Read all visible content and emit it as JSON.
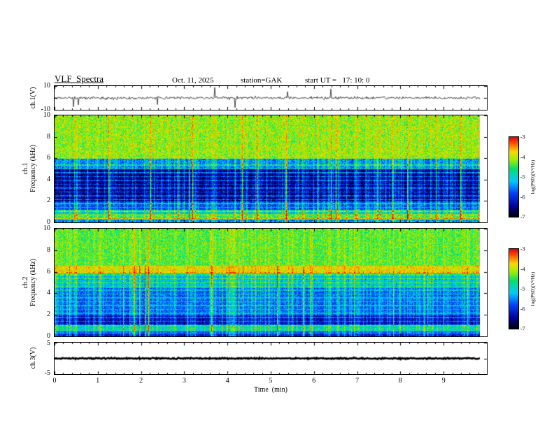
{
  "figure": {
    "title": "VLF  Spectra",
    "date": "Oct. 11, 2025",
    "station": "station=GAK",
    "start_ut": "start UT =   17: 10: 0"
  },
  "axes": {
    "time_label": "Time  (min)",
    "time_ticks": [
      "0",
      "1",
      "2",
      "3",
      "4",
      "5",
      "6",
      "7",
      "8",
      "9"
    ],
    "ch1_volt_ticks": [
      "10",
      "-10"
    ],
    "freq_ticks": [
      "10",
      "8",
      "6",
      "4",
      "2",
      "0"
    ],
    "ch3_volt_ticks": [
      "5",
      "-5"
    ],
    "ch1_volt_label": "ch.1(V)",
    "ch1_freq_label_line1": "ch.1",
    "ch1_freq_label_line2": "Frequency (kHz)",
    "ch2_freq_label_line1": "ch.2",
    "ch2_freq_label_line2": "Frequency (kHz)",
    "ch3_volt_label": "ch.3(V)"
  },
  "colorbar": {
    "label": "log(PSD)(V²/Hz)",
    "ticks": [
      "-3",
      "-4",
      "-5",
      "-6",
      "-7"
    ],
    "min": -7,
    "max": -3
  },
  "colormap": [
    [
      "0",
      "#000000"
    ],
    [
      "0.14",
      "#00009a"
    ],
    [
      "0.30",
      "#0040ff"
    ],
    [
      "0.45",
      "#00c8ff"
    ],
    [
      "0.60",
      "#00e070"
    ],
    [
      "0.72",
      "#9cf000"
    ],
    [
      "0.82",
      "#ffd800"
    ],
    [
      "0.92",
      "#ff5a00"
    ],
    [
      "1",
      "#e80000"
    ]
  ],
  "chart_data": [
    {
      "id": "ch1_waveform",
      "type": "line",
      "title": "ch.1 raw amplitude",
      "ylabel": "ch.1(V)",
      "ylim": [
        -10,
        10
      ],
      "yticks": [
        10,
        -10
      ],
      "xlim": [
        0,
        10
      ],
      "xlabel": "Time (min)",
      "description": "Black broadband noise trace centered on 0 V with ~±2 V ripple and sporadic impulsive sferic spikes reaching about ±10 V; data span 0 to ~9.8 min",
      "render": {
        "noise_sigma": 1.1,
        "spike_prob": 0.012,
        "spike_amp": [
          5,
          10
        ],
        "seed": 11,
        "thick": 0.7,
        "yticks_draw": [
          10,
          0,
          -10
        ]
      }
    },
    {
      "id": "ch1_spectrogram",
      "type": "heatmap",
      "title": "ch.1 VLF spectrogram",
      "ylabel": "ch.1 Frequency (kHz)",
      "ylim": [
        0,
        10
      ],
      "yticks": [
        0,
        2,
        4,
        6,
        8,
        10
      ],
      "xlim": [
        0,
        10
      ],
      "xlabel": "Time (min)",
      "value_label": "log(PSD)(V²/Hz)",
      "value_range": [
        -7,
        -3
      ],
      "description": "Dense vertical sferic streaks across all frequencies; 6-10 kHz band bright green-yellow with frequent red streaks near -3; 2-6 kHz mostly dark blue/black near -7 with cyan-green streaks; narrow horizontal power-line harmonic lines below ~5.5 kHz; bright green-yellow band below ~1 kHz",
      "render": {
        "seed": 21,
        "noise": 0.9,
        "profile": [
          {
            "f": [
              6,
              10.01
            ],
            "level": -4.2
          },
          {
            "f": [
              5,
              6
            ],
            "level": -5.6
          },
          {
            "f": [
              2,
              5
            ],
            "level": -6.6
          },
          {
            "f": [
              1.2,
              2
            ],
            "level": -5.9
          },
          {
            "f": [
              0.8,
              1.2
            ],
            "level": -5.2
          },
          {
            "f": [
              0.35,
              0.8
            ],
            "level": -4.6
          },
          {
            "f": [
              0,
              0.35
            ],
            "level": -5.6
          }
        ],
        "streak_gain": [
          {
            "f": [
              6,
              10.01
            ],
            "g": 0.45
          },
          {
            "f": [
              0,
              6
            ],
            "g": 1.5
          }
        ],
        "harmonics": {
          "spacing": 0.36,
          "fmax": 5.5,
          "boost": 1.0
        },
        "yticks_draw": [
          0,
          2,
          4,
          6,
          8,
          10
        ]
      }
    },
    {
      "id": "ch2_spectrogram",
      "type": "heatmap",
      "title": "ch.2 VLF spectrogram",
      "ylabel": "ch.2 Frequency (kHz)",
      "ylim": [
        0,
        10
      ],
      "yticks": [
        0,
        2,
        4,
        6,
        8,
        10
      ],
      "xlim": [
        0,
        10
      ],
      "xlabel": "Time (min)",
      "value_label": "log(PSD)(V²/Hz)",
      "value_range": [
        -7,
        -3
      ],
      "description": "Green 6.5-10 kHz band with occasional red sferic streaks; bright yellow-orange horizontal band near 6-6.5 kHz; 2-6 kHz mottled cyan-blue; 1-2 kHz darker blue; bright narrow band near 0.8 kHz; horizontal harmonic lines below ~6 kHz",
      "render": {
        "seed": 31,
        "noise": 0.8,
        "profile": [
          {
            "f": [
              6.6,
              10.01
            ],
            "level": -4.4
          },
          {
            "f": [
              5.9,
              6.6
            ],
            "level": -3.9
          },
          {
            "f": [
              4.5,
              5.9
            ],
            "level": -5.3
          },
          {
            "f": [
              2,
              4.5
            ],
            "level": -5.8
          },
          {
            "f": [
              1.1,
              2
            ],
            "level": -6.4
          },
          {
            "f": [
              0.5,
              1.1
            ],
            "level": -5.1
          },
          {
            "f": [
              0,
              0.5
            ],
            "level": -6.2
          }
        ],
        "streak_gain": [
          {
            "f": [
              6,
              10.01
            ],
            "g": 0.45
          },
          {
            "f": [
              0,
              6
            ],
            "g": 1.2
          }
        ],
        "harmonics": {
          "spacing": 0.36,
          "fmax": 6.0,
          "boost": 0.7
        },
        "yticks_draw": [
          0,
          2,
          4,
          6,
          8,
          10
        ]
      }
    },
    {
      "id": "ch3_waveform",
      "type": "line",
      "title": "ch.3 raw amplitude",
      "ylabel": "ch.3(V)",
      "ylim": [
        -5,
        5
      ],
      "yticks": [
        5,
        -5
      ],
      "xlim": [
        0,
        10
      ],
      "xlabel": "Time (min)",
      "description": "Flat dense black trace pinned at 0 V for the whole record (no signal on channel 3)",
      "render": {
        "noise_sigma": 0.22,
        "spike_prob": 0,
        "spike_amp": [
          0,
          0
        ],
        "seed": 41,
        "thick": 2.5,
        "yticks_draw": [
          5,
          0,
          -5
        ]
      }
    }
  ]
}
